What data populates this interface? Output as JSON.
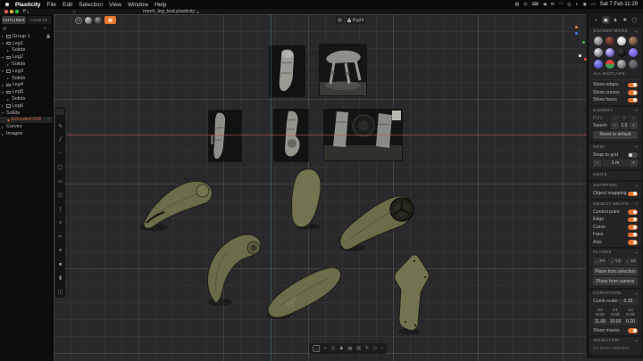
{
  "colors": {
    "accent": "#e8782f",
    "model_olive": "#6c6c4b",
    "viewport_bg": "#29292b",
    "axis_x": "#c35555",
    "axis_z": "#48878e",
    "highlight_orange": "#d2663a"
  },
  "menubar": {
    "app": "Plasticity",
    "items": [
      "File",
      "Edit",
      "Selection",
      "View",
      "Window",
      "Help"
    ],
    "status": [
      {
        "name": "stage-manager-icon",
        "glyph": "▤"
      },
      {
        "name": "display-icon",
        "glyph": "⊡"
      },
      {
        "name": "keyboard-icon",
        "glyph": "⌨"
      },
      {
        "name": "sound-icon",
        "glyph": "◀"
      },
      {
        "name": "mail-icon",
        "glyph": "✉"
      },
      {
        "name": "wifi-icon",
        "glyph": "◠"
      },
      {
        "name": "spotlight-icon",
        "glyph": "◎"
      },
      {
        "name": "control-center-icon",
        "glyph": "◐"
      },
      {
        "name": "siri-icon",
        "glyph": "◉"
      },
      {
        "name": "battery-icon",
        "glyph": "▭"
      }
    ],
    "clock": "Sat 7 Feb 11:29"
  },
  "titlebar": {
    "logo": "P",
    "logo_chevron": "▾",
    "title": "mech_leg_test.plasticity",
    "modified": "●"
  },
  "outliner": {
    "tabs": [
      {
        "label": "OUTLINER",
        "active": true
      },
      {
        "label": "ASSETS",
        "active": false
      }
    ],
    "filter_icons": [
      {
        "name": "filter-icon",
        "glyph": "▤"
      },
      {
        "name": "sort-icon",
        "glyph": "▾"
      },
      {
        "name": "collapse-all-icon",
        "glyph": "−"
      }
    ],
    "items": [
      {
        "exp": "▸",
        "label": "Group 1",
        "locked": true
      },
      {
        "exp": "▾",
        "label": "Leg1"
      },
      {
        "exp": "▸",
        "label": "Solids",
        "depth": 1
      },
      {
        "exp": "▾",
        "label": "Leg2"
      },
      {
        "exp": "▸",
        "label": "Solids",
        "depth": 1
      },
      {
        "exp": "▾",
        "label": "Leg3"
      },
      {
        "exp": "▸",
        "label": "Solids",
        "depth": 1
      },
      {
        "exp": "▸",
        "label": "Leg4"
      },
      {
        "exp": "▾",
        "label": "Leg5"
      },
      {
        "exp": "▸",
        "label": "Solids",
        "depth": 1
      },
      {
        "exp": "▸",
        "label": "Leg6"
      },
      {
        "exp": "▾",
        "label": "Solids"
      },
      {
        "label": "Extruded 008",
        "depth": 1,
        "highlight": true,
        "suffix": "~"
      },
      {
        "exp": "▸",
        "label": "Curves"
      },
      {
        "exp": "▸",
        "label": "Images"
      }
    ]
  },
  "viewport": {
    "mode_buttons": [
      {
        "name": "xray-mode",
        "glyph": "⊘"
      },
      {
        "name": "shaded-mode",
        "glyph": ""
      },
      {
        "name": "rendered-mode",
        "glyph": ""
      },
      {
        "name": "matcap-mode",
        "glyph": "▦",
        "active": true
      }
    ],
    "view_widget": {
      "grid_glyph": "⊞",
      "label": "Right"
    },
    "left_tools": [
      {
        "name": "pencil-tool",
        "glyph": "✎"
      },
      {
        "name": "line-tool",
        "glyph": "╱"
      },
      {
        "name": "arc-tool",
        "glyph": "◠"
      },
      {
        "name": "circle-tool",
        "glyph": "◯"
      },
      {
        "name": "rect-tool",
        "glyph": "▭"
      },
      {
        "name": "box-tool",
        "glyph": "◻"
      },
      {
        "name": "spline-tool",
        "glyph": "ʃ"
      },
      {
        "name": "offset-tool",
        "glyph": "≡"
      },
      {
        "name": "trim-tool",
        "glyph": "✂"
      },
      {
        "name": "sphere-tool",
        "glyph": "●"
      },
      {
        "name": "cube-tool",
        "glyph": "■"
      },
      {
        "name": "cylinder-tool",
        "glyph": "▮"
      },
      {
        "name": "mirror-tool",
        "glyph": "◫"
      }
    ],
    "bottom_tools": [
      {
        "name": "select-box-tool",
        "glyph": "□"
      },
      {
        "name": "add-tool",
        "glyph": "+"
      },
      {
        "name": "pivot-tool",
        "glyph": "◎"
      },
      {
        "name": "mannequin-tool",
        "glyph": "♟"
      },
      {
        "name": "note-tool",
        "glyph": "▤"
      },
      {
        "name": "layers-tool",
        "glyph": "▥"
      },
      {
        "name": "pen-tool",
        "glyph": "✎"
      },
      {
        "name": "primitive-tool",
        "glyph": "◇"
      },
      {
        "name": "collapse-toolbar",
        "glyph": "−"
      }
    ]
  },
  "inspector": {
    "tabs": [
      {
        "name": "shading-tab",
        "glyph": "◖"
      },
      {
        "name": "scene-tab",
        "glyph": "▣",
        "active": true
      },
      {
        "name": "pose-tab",
        "glyph": "♟"
      },
      {
        "name": "settings-tab",
        "glyph": "✱"
      },
      {
        "name": "render-tab",
        "glyph": "◯"
      }
    ],
    "shader": {
      "title": "SHADER MODE",
      "all_matcaps": "ALL MATCAPS",
      "matcap_colors": [
        "#8d8d8d",
        "#7a4438",
        "#e8e8e8",
        "#8a6a52",
        "#b5b5bd",
        "#9a8ad0",
        "#1a1a1a",
        "#7a5fd0",
        "#6a6ae0",
        "#d6453a",
        "#8f8f8f",
        "#5a5a5c"
      ]
    },
    "display_toggles": [
      {
        "label": "Show edges",
        "on": true
      },
      {
        "label": "Show curves",
        "on": true
      },
      {
        "label": "Show faces",
        "on": true
      }
    ],
    "camera": {
      "title": "CAMERA",
      "fov_label": "FOV",
      "fov_value": "0",
      "squish_label": "Squish",
      "squish_value": "1.0",
      "reset_label": "Reset to default"
    },
    "grid": {
      "title": "GRID",
      "snap_label": "Snap to grid",
      "snap_on": false,
      "size_value": "1 m"
    },
    "units": {
      "title": "UNITS"
    },
    "snapping": {
      "title": "SNAPPING",
      "object_label": "Object snapping",
      "on": true
    },
    "object_snaps": {
      "title": "OBJECT SNAPS",
      "toggles": [
        {
          "label": "Control point",
          "on": true
        },
        {
          "label": "Edge",
          "on": true
        },
        {
          "label": "Curve",
          "on": true
        },
        {
          "label": "Face",
          "on": true
        },
        {
          "label": "Axis",
          "on": true
        }
      ]
    },
    "planes": {
      "title": "PLANES",
      "axes": [
        "XY",
        "YZ",
        "XZ"
      ],
      "from_selection": "Plane from selection",
      "from_camera": "Plane from camera"
    },
    "curvature": {
      "title": "CURVATURE",
      "comb_label": "Comb scale:",
      "comb_value": "0.10",
      "columns": [
        {
          "label": "G0 Scale",
          "value": "11.00"
        },
        {
          "label": "G1 Scale",
          "value": "10.00"
        },
        {
          "label": "G2 Scale",
          "value": "0.20"
        }
      ],
      "show_maxes_label": "Show maxes",
      "show_maxes_on": true
    },
    "selection": {
      "title": "SELECTION",
      "empty": "No items selected"
    }
  }
}
